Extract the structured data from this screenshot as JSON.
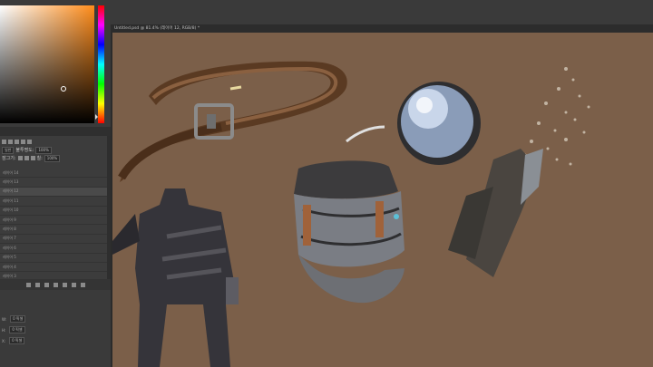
{
  "document": {
    "tab_label": "Untitled.psd @ 81.4% (레이어 12, RGB/8) *"
  },
  "layers_panel": {
    "mode_label": "일반",
    "opacity_label": "불투명도:",
    "opacity_value": "100%",
    "lock_label": "잠그기:",
    "fill_label": "칠:",
    "fill_value": "100%",
    "layers": [
      {
        "name": "레이어 14"
      },
      {
        "name": "레이어 13"
      },
      {
        "name": "레이어 12"
      },
      {
        "name": "레이어 11"
      },
      {
        "name": "레이어 10"
      },
      {
        "name": "레이어 9"
      },
      {
        "name": "레이어 8"
      },
      {
        "name": "레이어 7"
      },
      {
        "name": "레이어 6"
      },
      {
        "name": "레이어 5"
      },
      {
        "name": "레이어 4"
      },
      {
        "name": "레이어 3"
      }
    ]
  },
  "properties_panel": {
    "width_label": "W:",
    "width_value": "0 픽셀",
    "height_label": "H:",
    "height_value": "0 픽셀",
    "x_label": "X:",
    "x_value": "0 픽셀"
  },
  "colors": {
    "canvas_bg": "#7b5f49",
    "foreground": "#ff8c1a"
  }
}
